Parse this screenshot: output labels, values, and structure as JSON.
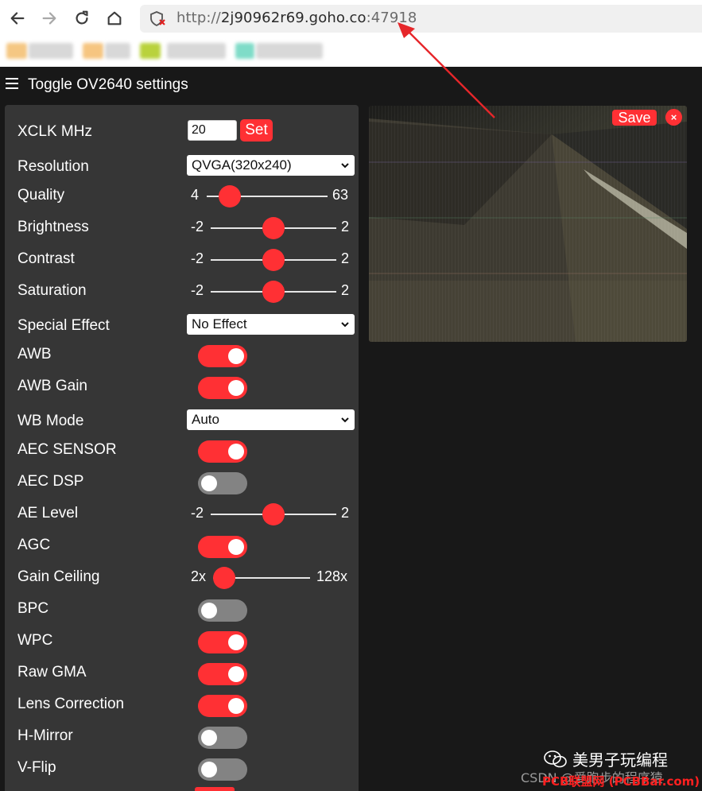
{
  "browser": {
    "url_prefix": "http://",
    "url_host": "2j90962r69.goho.co",
    "url_port": ":47918"
  },
  "header": {
    "toggle_label": "Toggle OV2640 settings"
  },
  "settings": {
    "xclk": {
      "label": "XCLK MHz",
      "value": "20",
      "button": "Set"
    },
    "resolution": {
      "label": "Resolution",
      "selected": "QVGA(320x240)"
    },
    "quality": {
      "label": "Quality",
      "min": "4",
      "max": "63",
      "level": 0.0
    },
    "brightness": {
      "label": "Brightness",
      "min": "-2",
      "max": "2",
      "level": 0.5
    },
    "contrast": {
      "label": "Contrast",
      "min": "-2",
      "max": "2",
      "level": 0.5
    },
    "saturation": {
      "label": "Saturation",
      "min": "-2",
      "max": "2",
      "level": 0.5
    },
    "special_effect": {
      "label": "Special Effect",
      "selected": "No Effect"
    },
    "awb": {
      "label": "AWB",
      "on": true
    },
    "awb_gain": {
      "label": "AWB Gain",
      "on": true
    },
    "wb_mode": {
      "label": "WB Mode",
      "selected": "Auto"
    },
    "aec_sensor": {
      "label": "AEC SENSOR",
      "on": true
    },
    "aec_dsp": {
      "label": "AEC DSP",
      "on": false
    },
    "ae_level": {
      "label": "AE Level",
      "min": "-2",
      "max": "2",
      "level": 0.5
    },
    "agc": {
      "label": "AGC",
      "on": true
    },
    "gain_ceiling": {
      "label": "Gain Ceiling",
      "min": "2x",
      "max": "128x",
      "level": 0.0
    },
    "bpc": {
      "label": "BPC",
      "on": false
    },
    "wpc": {
      "label": "WPC",
      "on": true
    },
    "raw_gma": {
      "label": "Raw GMA",
      "on": true
    },
    "lens_correction": {
      "label": "Lens Correction",
      "on": true
    },
    "h_mirror": {
      "label": "H-Mirror",
      "on": false
    },
    "v_flip": {
      "label": "V-Flip",
      "on": false
    }
  },
  "stream": {
    "save_label": "Save",
    "close_label": "×"
  },
  "watermark": {
    "wechat_name": "美男子玩编程",
    "csdn": "CSDN @爱跑步的程序猿",
    "pcb": "PCB联盟网 (PCBBar.com)"
  },
  "colors": {
    "accent": "#ff3034",
    "panel_bg": "#363636",
    "page_bg": "#181818",
    "switch_off": "#838383"
  }
}
